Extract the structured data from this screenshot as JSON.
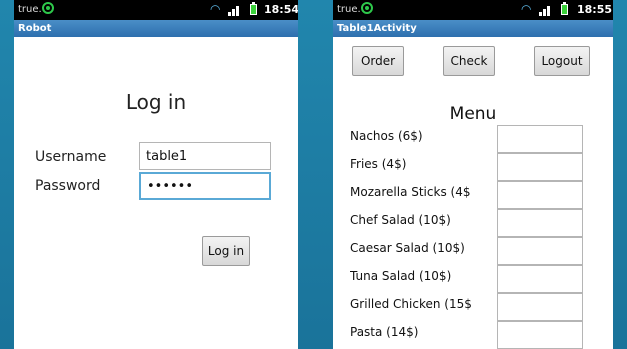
{
  "login_screen": {
    "status": {
      "carrier": "true.",
      "time": "18:54"
    },
    "app_title": "Robot",
    "heading": "Log in",
    "username_label": "Username",
    "username_value": "table1",
    "password_label": "Password",
    "password_value": "••••••",
    "login_button": "Log in"
  },
  "menu_screen": {
    "status": {
      "carrier": "true.",
      "time": "18:55"
    },
    "app_title": "Table1Activity",
    "buttons": {
      "order": "Order",
      "check": "Check",
      "logout": "Logout"
    },
    "menu_title": "Menu",
    "items": [
      {
        "name": "Nachos (6$)"
      },
      {
        "name": "Fries (4$)"
      },
      {
        "name": "Mozarella Sticks (4$"
      },
      {
        "name": "Chef Salad (10$)"
      },
      {
        "name": "Caesar Salad (10$)"
      },
      {
        "name": "Tuna Salad (10$)"
      },
      {
        "name": "Grilled Chicken (15$"
      },
      {
        "name": "Pasta (14$)"
      }
    ]
  }
}
